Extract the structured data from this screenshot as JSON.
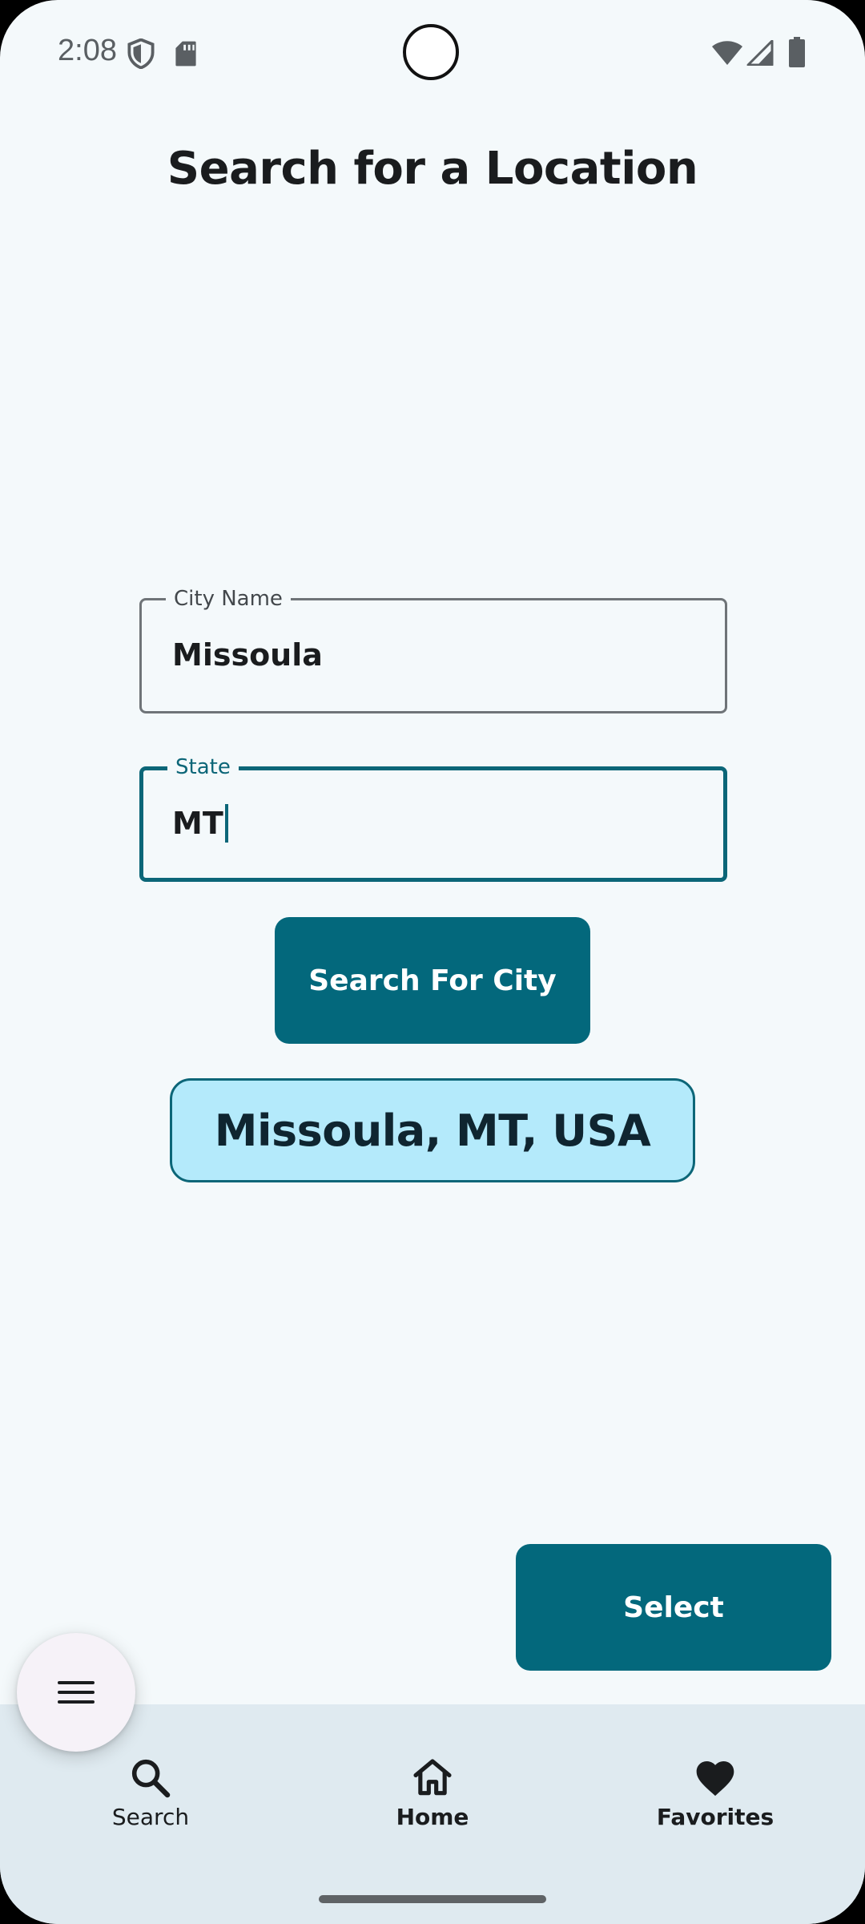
{
  "status_bar": {
    "time": "2:08",
    "icons": [
      "shield-icon",
      "sd-card-icon",
      "wifi-icon",
      "signal-icon",
      "battery-icon"
    ]
  },
  "page": {
    "title": "Search for a Location"
  },
  "form": {
    "city": {
      "label": "City Name",
      "value": "Missoula"
    },
    "state": {
      "label": "State",
      "value": "MT"
    },
    "search_button": "Search For City"
  },
  "result": {
    "label": "Missoula, MT, USA"
  },
  "actions": {
    "select_button": "Select",
    "fab_icon": "menu-icon"
  },
  "bottom_nav": {
    "items": [
      {
        "label": "Search",
        "icon": "search-icon"
      },
      {
        "label": "Home",
        "icon": "home-icon"
      },
      {
        "label": "Favorites",
        "icon": "heart-icon"
      }
    ]
  },
  "colors": {
    "primary": "#03687c",
    "background": "#f4f9fb",
    "result_chip": "#b4eafb",
    "nav_background": "#dfeaf0"
  }
}
